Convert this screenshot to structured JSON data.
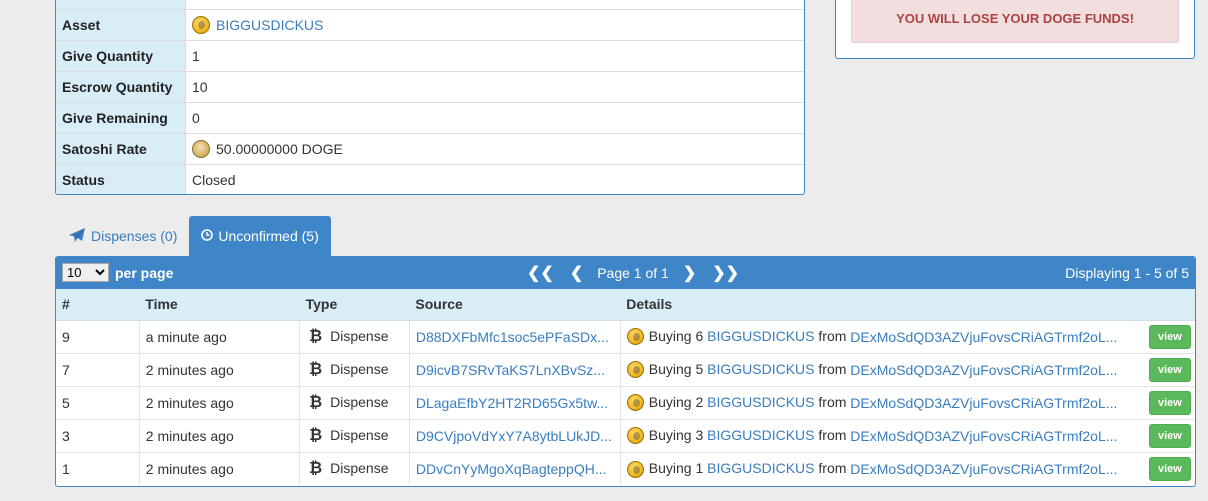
{
  "details": {
    "rows": [
      {
        "label": "Asset",
        "value": "BIGGUSDICKUS"
      },
      {
        "label": "Give Quantity",
        "value": "1"
      },
      {
        "label": "Escrow Quantity",
        "value": "10"
      },
      {
        "label": "Give Remaining",
        "value": "0"
      },
      {
        "label": "Satoshi Rate",
        "value": "50.00000000 DOGE"
      },
      {
        "label": "Status",
        "value": "Closed"
      }
    ]
  },
  "warning": {
    "text": "YOU WILL LOSE YOUR DOGE FUNDS!"
  },
  "tabs": [
    {
      "label": "Dispenses (0)",
      "icon": "paper-plane-icon"
    },
    {
      "label": "Unconfirmed (5)",
      "icon": "clock-icon"
    }
  ],
  "table": {
    "per_page_value": "10",
    "per_page_label": "per page",
    "page_text": "Page 1 of 1",
    "displaying": "Displaying 1 - 5 of 5",
    "headers": [
      "#",
      "Time",
      "Type",
      "Source",
      "Details"
    ],
    "rows": [
      {
        "num": "9",
        "time": "a minute ago",
        "type": "Dispense",
        "source": "D88DXFbMfc1soc5ePFaSDx...",
        "buying": "Buying 6",
        "asset": "BIGGUSDICKUS",
        "from": "from",
        "address": "DExMoSdQD3AZVjuFovsCRiAGTrmf2oL...",
        "view": "view"
      },
      {
        "num": "7",
        "time": "2 minutes ago",
        "type": "Dispense",
        "source": "D9icvB7SRvTaKS7LnXBvSz...",
        "buying": "Buying 5",
        "asset": "BIGGUSDICKUS",
        "from": "from",
        "address": "DExMoSdQD3AZVjuFovsCRiAGTrmf2oL...",
        "view": "view"
      },
      {
        "num": "5",
        "time": "2 minutes ago",
        "type": "Dispense",
        "source": "DLagaEfbY2HT2RD65Gx5tw...",
        "buying": "Buying 2",
        "asset": "BIGGUSDICKUS",
        "from": "from",
        "address": "DExMoSdQD3AZVjuFovsCRiAGTrmf2oL...",
        "view": "view"
      },
      {
        "num": "3",
        "time": "2 minutes ago",
        "type": "Dispense",
        "source": "D9CVjpoVdYxY7A8ytbLUkJD...",
        "buying": "Buying 3",
        "asset": "BIGGUSDICKUS",
        "from": "from",
        "address": "DExMoSdQD3AZVjuFovsCRiAGTrmf2oL...",
        "view": "view"
      },
      {
        "num": "1",
        "time": "2 minutes ago",
        "type": "Dispense",
        "source": "DDvCnYyMgoXqBagteppQH...",
        "buying": "Buying 1",
        "asset": "BIGGUSDICKUS",
        "from": "from",
        "address": "DExMoSdQD3AZVjuFovsCRiAGTrmf2oL...",
        "view": "view"
      }
    ]
  }
}
